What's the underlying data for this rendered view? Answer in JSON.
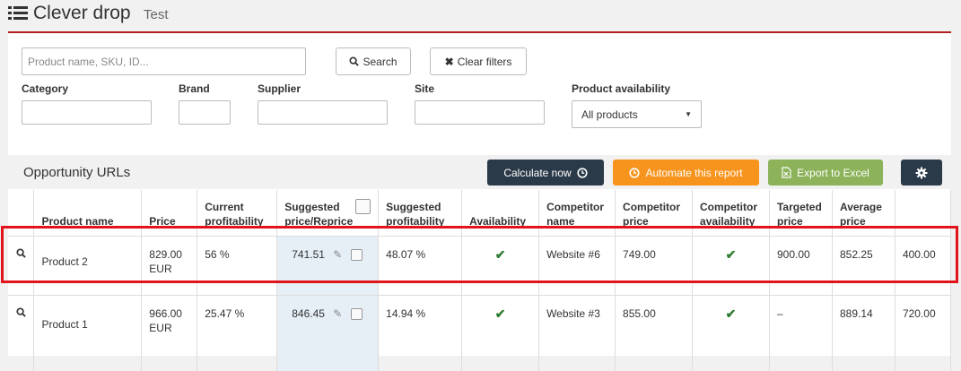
{
  "header": {
    "title": "Clever drop",
    "subtitle": "Test"
  },
  "filters": {
    "search_placeholder": "Product name, SKU, ID...",
    "search_button": "Search",
    "clear_button": "Clear filters",
    "category_label": "Category",
    "brand_label": "Brand",
    "supplier_label": "Supplier",
    "site_label": "Site",
    "availability_label": "Product availability",
    "availability_value": "All products"
  },
  "section": {
    "title": "Opportunity URLs",
    "calculate_button": "Calculate now",
    "automate_button": "Automate this report",
    "export_button": "Export to Excel"
  },
  "colors": {
    "accent": "#b51e1e",
    "dark_button": "#2b3a48",
    "orange_button": "#f7941d",
    "green_button": "#8cb35a",
    "highlight": "#e1141c"
  },
  "table": {
    "headers": {
      "product_name": "Product name",
      "price": "Price",
      "current_profitability": "Current profitability",
      "suggested_price": "Suggested price/Reprice",
      "suggested_profitability": "Suggested profitability",
      "availability": "Availability",
      "competitor_name": "Competitor name",
      "competitor_price": "Competitor price",
      "competitor_availability": "Competitor availability",
      "targeted_price": "Targeted price",
      "average_price": "Average price"
    },
    "rows": [
      {
        "product_name": "Product 2",
        "price": "829.00 EUR",
        "current_profitability": "56 %",
        "suggested_price": "741.51",
        "suggested_profitability": "48.07 %",
        "availability": "✔",
        "competitor_name": "Website #6",
        "competitor_price": "749.00",
        "competitor_availability": "✔",
        "targeted_price": "900.00",
        "average_price": "852.25",
        "extra": "400.00"
      },
      {
        "product_name": "Product 1",
        "price": "966.00 EUR",
        "current_profitability": "25.47 %",
        "suggested_price": "846.45",
        "suggested_profitability": "14.94 %",
        "availability": "✔",
        "competitor_name": "Website #3",
        "competitor_price": "855.00",
        "competitor_availability": "✔",
        "targeted_price": "–",
        "average_price": "889.14",
        "extra": "720.00"
      }
    ]
  }
}
